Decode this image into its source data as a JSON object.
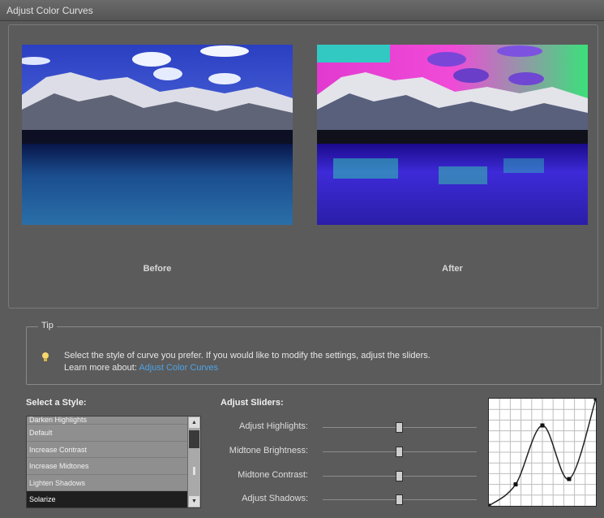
{
  "window": {
    "title": "Adjust Color Curves"
  },
  "preview": {
    "before_label": "Before",
    "after_label": "After"
  },
  "tip": {
    "title": "Tip",
    "text": "Select the style of curve you prefer. If you would like to modify the settings, adjust the sliders.",
    "learn_more": "Learn more about:",
    "link": "Adjust Color Curves"
  },
  "style_select": {
    "heading": "Select a Style:",
    "items": [
      "Darken Highlights",
      "Default",
      "Increase Contrast",
      "Increase Midtones",
      "Lighten Shadows",
      "Solarize"
    ],
    "selected": "Solarize"
  },
  "sliders": {
    "heading": "Adjust Sliders:",
    "items": [
      {
        "label": "Adjust Highlights:",
        "value": 0.5
      },
      {
        "label": "Midtone Brightness:",
        "value": 0.5
      },
      {
        "label": "Midtone Contrast:",
        "value": 0.5
      },
      {
        "label": "Adjust Shadows:",
        "value": 0.5
      }
    ]
  },
  "curve": {
    "points": [
      [
        0,
        0
      ],
      [
        0.25,
        0.2
      ],
      [
        0.5,
        0.75
      ],
      [
        0.75,
        0.25
      ],
      [
        1,
        1
      ]
    ]
  },
  "colors": {
    "dialog_bg": "#5b5b5b",
    "selected_item_bg": "#1f1f1f",
    "link": "#4ea4e8",
    "tip_bulb": "#f5d76e"
  }
}
